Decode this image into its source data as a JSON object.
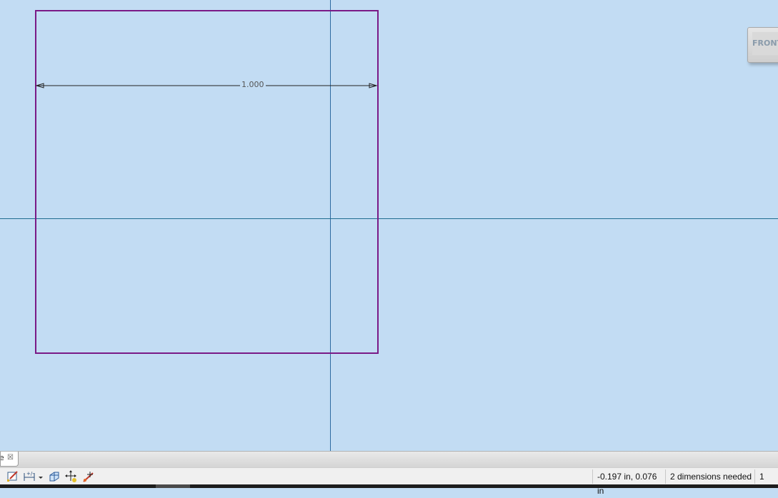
{
  "viewport": {
    "dimension_value": "1.000",
    "viewcube_label": "FRONT"
  },
  "document_tab": {
    "label": "e",
    "close_glyph": "☒"
  },
  "toolbar": {
    "tools": [
      {
        "icon": "sketch-edit-icon"
      },
      {
        "icon": "dimension-icon"
      },
      {
        "icon": "dropdown-arrow-icon"
      },
      {
        "icon": "view-face-icon"
      },
      {
        "icon": "move-icon"
      },
      {
        "icon": "constraint-icon"
      }
    ]
  },
  "status": {
    "coordinates": "-0.197 in, 0.076 in",
    "message": "2 dimensions needed",
    "count": "1"
  },
  "colors": {
    "canvas": "#c2dcf3",
    "sketch_line": "#7a1a86",
    "axis": "#2d6aa0"
  }
}
